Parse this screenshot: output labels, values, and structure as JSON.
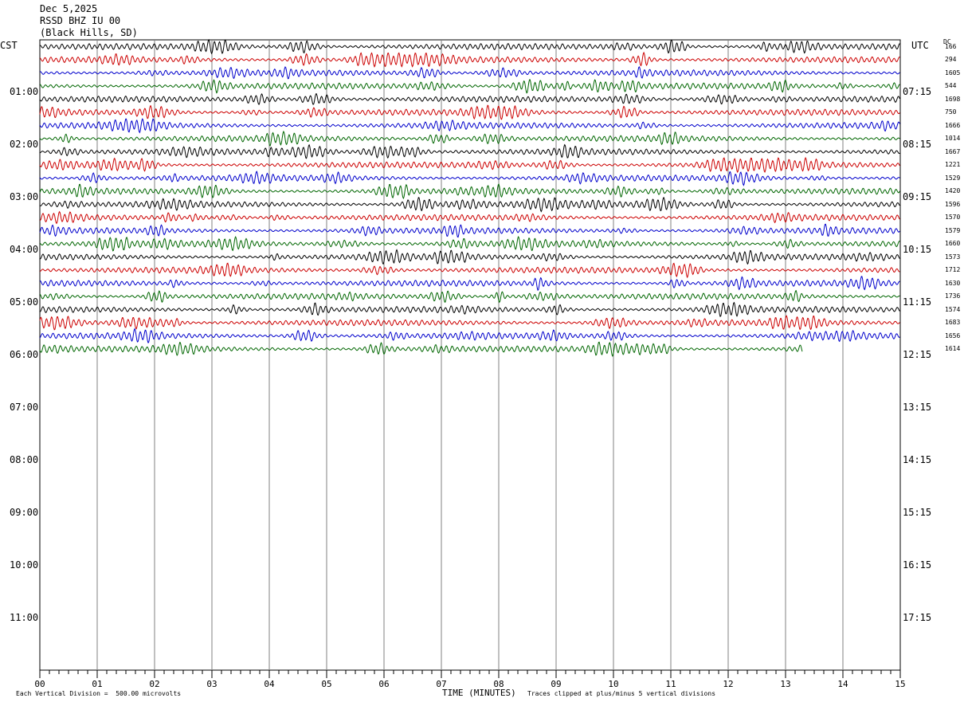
{
  "header": {
    "date": "Dec 5,2025",
    "station": "RSSD BHZ IU 00",
    "location": "(Black Hills, SD)"
  },
  "left_tz": "CST",
  "right_tz": "UTC",
  "dc_label": "DC",
  "footer": {
    "scale": "Each Vertical Division =  500.00 microvolts",
    "xtitle": "TIME (MINUTES)",
    "clip": "Traces clipped at plus/minus 5 vertical divisions"
  },
  "colors": {
    "cycle": [
      "#000000",
      "#cc0000",
      "#0000cc",
      "#006600"
    ],
    "grid": "#808080"
  },
  "chart_data": {
    "type": "line",
    "title": "",
    "xlabel": "TIME (MINUTES)",
    "xlim": [
      0,
      15
    ],
    "x_ticks": [
      "00",
      "01",
      "02",
      "03",
      "04",
      "05",
      "06",
      "07",
      "08",
      "09",
      "10",
      "11",
      "12",
      "13",
      "14",
      "15"
    ],
    "hour_labels_cst": [
      "01:00",
      "02:00",
      "03:00",
      "04:00",
      "05:00",
      "06:00",
      "07:00",
      "08:00",
      "09:00",
      "10:00",
      "11:00"
    ],
    "hour_labels_utc": [
      "07:15",
      "08:15",
      "09:15",
      "10:15",
      "11:15",
      "12:15",
      "13:15",
      "14:15",
      "15:15",
      "16:15",
      "17:15"
    ],
    "trace_minutes": 15,
    "traces_total": 24,
    "last_trace_end_minute": 13.3,
    "dc_offsets": [
      "166",
      "294",
      "1605",
      "544",
      "1698",
      "750",
      "1666",
      "1014",
      "1667",
      "1221",
      "1529",
      "1420",
      "1596",
      "1570",
      "1579",
      "1660",
      "1573",
      "1712",
      "1630",
      "1736",
      "1574",
      "1683",
      "1656",
      "1614"
    ]
  }
}
